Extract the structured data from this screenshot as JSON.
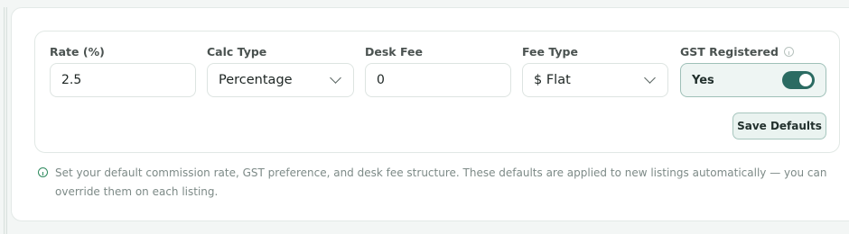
{
  "fields": {
    "rate": {
      "label": "Rate (%)",
      "value": "2.5"
    },
    "calc_type": {
      "label": "Calc Type",
      "value": "Percentage"
    },
    "desk_fee": {
      "label": "Desk Fee",
      "value": "0"
    },
    "fee_type": {
      "label": "Fee Type",
      "value": "$ Flat"
    },
    "gst": {
      "label": "GST Registered",
      "value": "Yes",
      "on": true
    }
  },
  "actions": {
    "save_label": "Save Defaults"
  },
  "hint": "Set your default commission rate, GST preference, and desk fee structure. These defaults are applied to new listings automatically — you can override them on each listing.",
  "colors": {
    "accent": "#2b6b62",
    "info_green": "#2e8a5e"
  },
  "icons": {
    "hint": "info-icon",
    "gst_info": "info-icon",
    "select": "chevron-down-icon"
  }
}
